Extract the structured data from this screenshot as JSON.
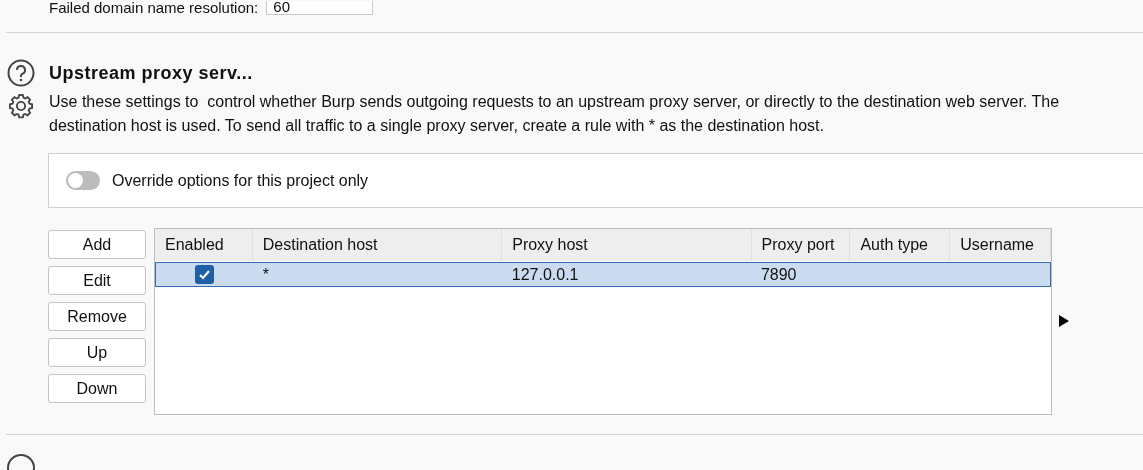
{
  "previous_field": {
    "label": "Failed domain name resolution:",
    "value": "60"
  },
  "section": {
    "title": "Upstream proxy serv...",
    "description": "Use these settings to  control whether Burp sends outgoing requests to an upstream proxy server, or directly to the destination web server. The\ndestination host is used. To send all traffic to a single proxy server, create a rule with * as the destination host."
  },
  "override_toggle": {
    "label": "Override options for this project only",
    "on": false
  },
  "buttons": [
    "Add",
    "Edit",
    "Remove",
    "Up",
    "Down"
  ],
  "table": {
    "columns": [
      "Enabled",
      "Destination host",
      "Proxy host",
      "Proxy port",
      "Auth type",
      "Username"
    ],
    "rows": [
      {
        "enabled": true,
        "selected": true,
        "destination_host": "*",
        "proxy_host": "127.0.0.1",
        "proxy_port": "7890",
        "auth_type": "",
        "username": ""
      }
    ]
  }
}
